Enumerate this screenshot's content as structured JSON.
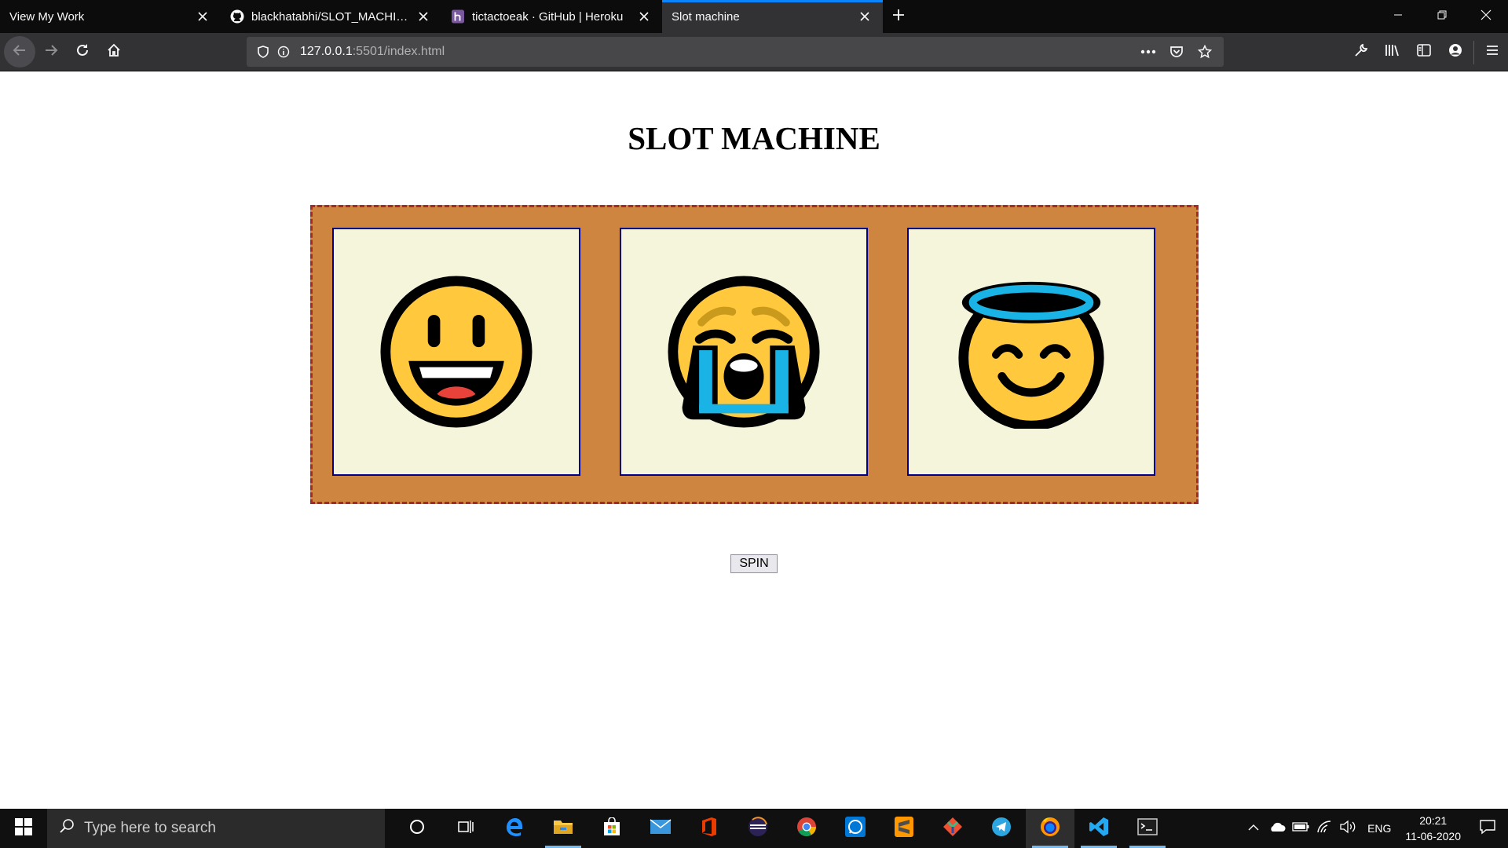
{
  "browser": {
    "tabs": [
      {
        "title": "View My Work",
        "favicon": "none",
        "active": false
      },
      {
        "title": "blackhatabhi/SLOT_MACHINE",
        "favicon": "github-icon",
        "active": false
      },
      {
        "title": "tictactoeak · GitHub | Heroku",
        "favicon": "heroku-icon",
        "active": false
      },
      {
        "title": "Slot machine",
        "favicon": "none",
        "active": true
      }
    ],
    "url": {
      "host": "127.0.0.1",
      "rest": ":5501/index.html"
    },
    "accent_color": "#0a84ff"
  },
  "page": {
    "title": "SLOT MACHINE",
    "slots": [
      {
        "emoji": "grinning-face"
      },
      {
        "emoji": "loudly-crying-face"
      },
      {
        "emoji": "smiling-face-with-halo"
      }
    ],
    "machine_color": "#cd853f",
    "machine_border_color": "#a52a2a",
    "slot_background": "#f5f5dc",
    "spin_label": "SPIN"
  },
  "taskbar": {
    "search_placeholder": "Type here to search",
    "apps": [
      "cortana-icon",
      "task-view-icon",
      "edge-icon",
      "file-explorer-icon",
      "store-icon",
      "mail-icon",
      "office-icon",
      "eclipse-icon",
      "chrome-icon",
      "whatsapp-icon",
      "sublime-icon",
      "git-icon",
      "telegram-icon",
      "firefox-icon",
      "vscode-icon",
      "terminal-icon"
    ],
    "language": "ENG",
    "time": "20:21",
    "date": "11-06-2020"
  }
}
